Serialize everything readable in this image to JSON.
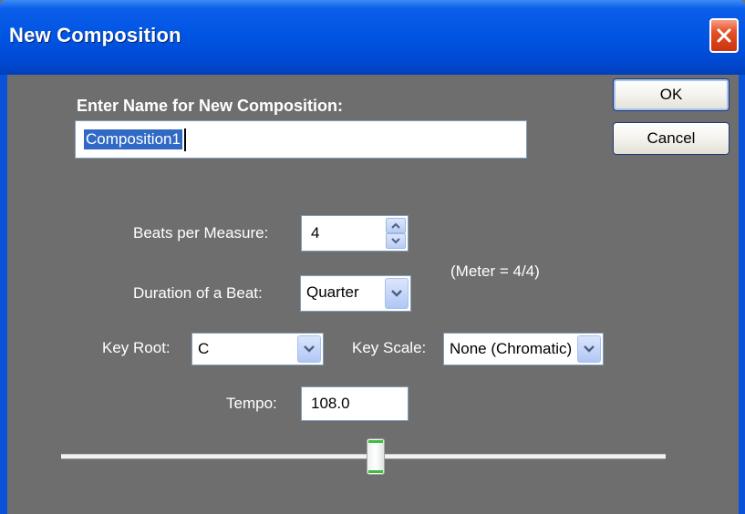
{
  "window": {
    "title": "New Composition"
  },
  "name_section": {
    "label": "Enter Name for New Composition:",
    "value": "Composition1"
  },
  "buttons": {
    "ok": "OK",
    "cancel": "Cancel"
  },
  "beats_per_measure": {
    "label": "Beats per Measure:",
    "value": "4"
  },
  "meter": {
    "text": "(Meter = 4/4)"
  },
  "duration_of_beat": {
    "label": "Duration of a Beat:",
    "value": "Quarter"
  },
  "key_root": {
    "label": "Key Root:",
    "value": "C"
  },
  "key_scale": {
    "label": "Key Scale:",
    "value": "None (Chromatic)"
  },
  "tempo": {
    "label": "Tempo:",
    "value": "108.0",
    "slider_fraction": 0.52
  },
  "colors": {
    "title_bar": "#0054e3",
    "close_button": "#e8542b",
    "background": "#6e6e6e",
    "selection": "#316ac5",
    "slider_accent": "#3fbb3f"
  },
  "icons": {
    "close": "close-x-icon",
    "spin_up": "spin-up-arrow-icon",
    "spin_down": "spin-down-arrow-icon",
    "dropdown": "chevron-down-icon"
  }
}
